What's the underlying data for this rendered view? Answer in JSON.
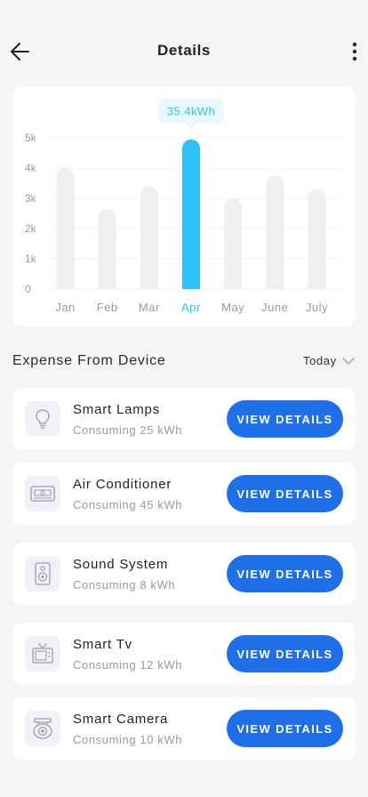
{
  "header": {
    "title": "Details",
    "back_icon": "arrow-left-icon",
    "menu_icon": "more-vertical-icon"
  },
  "chart_data": {
    "type": "bar",
    "categories": [
      "Jan",
      "Feb",
      "Mar",
      "Apr",
      "May",
      "June",
      "July"
    ],
    "values": [
      4000,
      2650,
      3400,
      4950,
      3000,
      3750,
      3300
    ],
    "y_tick_labels": [
      "0",
      "1k",
      "2k",
      "3k",
      "4k",
      "5k"
    ],
    "y_ticks": [
      0,
      1000,
      2000,
      3000,
      4000,
      5000
    ],
    "ylim": [
      0,
      5000
    ],
    "grid": true,
    "highlight_index": 3,
    "highlight_label": "35.4kWh",
    "colors": {
      "bar": "#efefef",
      "highlight": "#2ec0f9",
      "tooltip_bg": "#eaf7fd",
      "axis_text": "#9a9a9a"
    }
  },
  "expense": {
    "title": "Expense From Device",
    "period": "Today",
    "period_icon": "chevron-down-icon"
  },
  "devices": [
    {
      "id": "smart-lamps",
      "name": "Smart Lamps",
      "consumption": "Consuming 25 kWh",
      "icon": "lightbulb-icon",
      "button": "VIEW DETAILS"
    },
    {
      "id": "air-conditioner",
      "name": "Air Conditioner",
      "consumption": "Consuming 45 kWh",
      "icon": "air-conditioner-icon",
      "button": "VIEW DETAILS"
    },
    {
      "id": "sound-system",
      "name": "Sound System",
      "consumption": "Consuming 8 kWh",
      "icon": "speaker-icon",
      "button": "VIEW DETAILS"
    },
    {
      "id": "smart-tv",
      "name": "Smart Tv",
      "consumption": "Consuming 12 kWh",
      "icon": "tv-icon",
      "button": "VIEW DETAILS"
    },
    {
      "id": "smart-camera",
      "name": "Smart Camera",
      "consumption": "Consuming 10 kWh",
      "icon": "camera-icon",
      "button": "VIEW DETAILS"
    }
  ],
  "colors": {
    "accent": "#1f6fe8",
    "background": "#f5f5f7"
  }
}
